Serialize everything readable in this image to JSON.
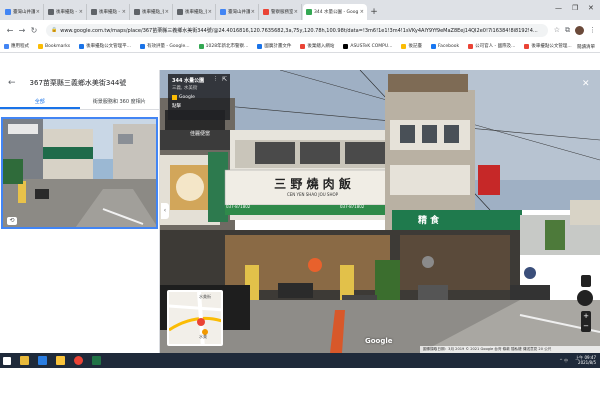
{
  "browser": {
    "tabs": [
      {
        "label": "臺灣山井護 - Google",
        "color": "#4285f4"
      },
      {
        "label": "後車擾點 - 臺院警察",
        "color": "#5f6368"
      },
      {
        "label": "後車擾點 - 臺院警察",
        "color": "#5f6368"
      },
      {
        "label": "後車擾點_後車擾點",
        "color": "#5f6368"
      },
      {
        "label": "後車擾點_後車擾點",
        "color": "#5f6368"
      },
      {
        "label": "臺灣山井護 - Google",
        "color": "#4285f4"
      },
      {
        "label": "警察服務室人員招聘",
        "color": "#ea4335"
      },
      {
        "label": "344 水量公園 - Goog",
        "color": "#34a853",
        "active": true
      }
    ],
    "new_tab": "+",
    "window_controls": [
      "—",
      "❐",
      "✕"
    ],
    "url": "www.google.com.tw/maps/place/367苗栗縣三義鄉水美街344號/@24.4016816,120.7635682,3a,75y,120.78h,100.98t/data=!3m6!1e1!3m4!1sVKy4AlY9Yf9eMaZ8Eej14QI2e0!7i16384!8i8192!4..."
  },
  "bookmarks": {
    "items": [
      {
        "label": "應用程式",
        "color": "#4285f4"
      },
      {
        "label": "Bookmarks",
        "color": "#fbbc04"
      },
      {
        "label": "後車擾點公文管理平...",
        "color": "#1a73e8"
      },
      {
        "label": "有效評量 - Google...",
        "color": "#1a73e8"
      },
      {
        "label": "1028年新北市警察...",
        "color": "#34a853"
      },
      {
        "label": "國廣計畫文件",
        "color": "#1a73e8"
      },
      {
        "label": "後業總入網站",
        "color": "#ea4335"
      },
      {
        "label": "ASUSTeK COMPU...",
        "color": "#000000"
      },
      {
        "label": "後記臺",
        "color": "#fbbc04"
      },
      {
        "label": "Facebook",
        "color": "#1877f2"
      },
      {
        "label": "公司官人 - 國際及...",
        "color": "#ea4335"
      },
      {
        "label": "後車擾點公文管理...",
        "color": "#ea4335"
      }
    ],
    "other": "閱讀清單"
  },
  "panel": {
    "back_icon": "arrow-left-icon",
    "title": "367苗栗縣三義鄉水美街344號",
    "tabs": [
      {
        "label": "全部",
        "selected": true
      },
      {
        "label": "街景服務和 360 度相片",
        "selected": false
      }
    ]
  },
  "infocard": {
    "title": "344 水量公園",
    "subtitle": "三義, 水美街",
    "source": "Google",
    "photo_label": "點擊"
  },
  "streetview": {
    "signs": {
      "main_title": "三 野 燒 肉 飯",
      "main_sub": "CEN YEN SHAO JOU SHOP",
      "left_sign": "佳麗便當",
      "side_sign": "精 食",
      "phone_left": "037-871802",
      "phone_right": "037-871802"
    },
    "google_logo": "Google",
    "copyright": "圖像擷取日期：3月 2019   © 2021 Google   台灣   條款   隱私權   傳送意見   20 公尺"
  },
  "minimap": {
    "label_top": "水美街",
    "label_bottom": "水美"
  },
  "taskbar": {
    "time": "上午 09:47",
    "date": "2021/8/5",
    "tray": "^ 中"
  }
}
